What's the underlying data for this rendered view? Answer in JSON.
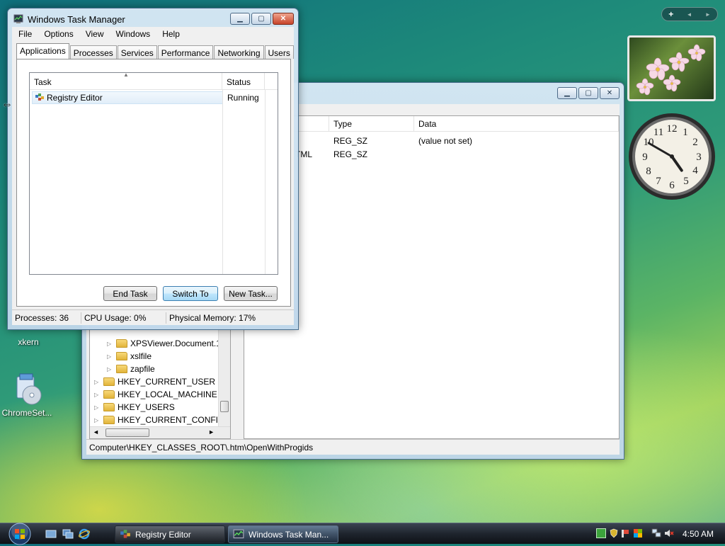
{
  "desktop": {
    "icons": [
      {
        "label": "xkern"
      },
      {
        "label": "ChromeSet..."
      }
    ]
  },
  "regedit": {
    "value_columns": [
      "Type",
      "Data"
    ],
    "values": [
      {
        "name_fragment": "",
        "type": "REG_SZ",
        "data": "(value not set)"
      },
      {
        "name_fragment": "TML",
        "type": "REG_SZ",
        "data": ""
      }
    ],
    "tree": [
      {
        "label": "XPSViewer.Document.1"
      },
      {
        "label": "xslfile"
      },
      {
        "label": "zapfile"
      },
      {
        "label": "HKEY_CURRENT_USER"
      },
      {
        "label": "HKEY_LOCAL_MACHINE"
      },
      {
        "label": "HKEY_USERS"
      },
      {
        "label": "HKEY_CURRENT_CONFIG"
      }
    ],
    "status_path": "Computer\\HKEY_CLASSES_ROOT\\.htm\\OpenWithProgids"
  },
  "taskmgr": {
    "title": "Windows Task Manager",
    "menu": [
      "File",
      "Options",
      "View",
      "Windows",
      "Help"
    ],
    "tabs": [
      "Applications",
      "Processes",
      "Services",
      "Performance",
      "Networking",
      "Users"
    ],
    "active_tab": "Applications",
    "columns": [
      "Task",
      "Status"
    ],
    "tasks": [
      {
        "task": "Registry Editor",
        "status": "Running"
      }
    ],
    "buttons": {
      "end_task": "End Task",
      "switch_to": "Switch To",
      "new_task": "New Task..."
    },
    "status": {
      "processes": "Processes: 36",
      "cpu": "CPU Usage: 0%",
      "memory": "Physical Memory: 17%"
    }
  },
  "gadgets": {
    "sidebar_controls": [
      "+",
      "◄",
      "►"
    ],
    "clock": {
      "hour": 4,
      "minute": 50
    }
  },
  "taskbar": {
    "buttons": [
      {
        "label": "Registry Editor"
      },
      {
        "label": "Windows Task Man..."
      }
    ],
    "clock": "4:50 AM"
  },
  "colors": {
    "accent": "#3c7fb1",
    "taskbar": "#1f252e"
  }
}
